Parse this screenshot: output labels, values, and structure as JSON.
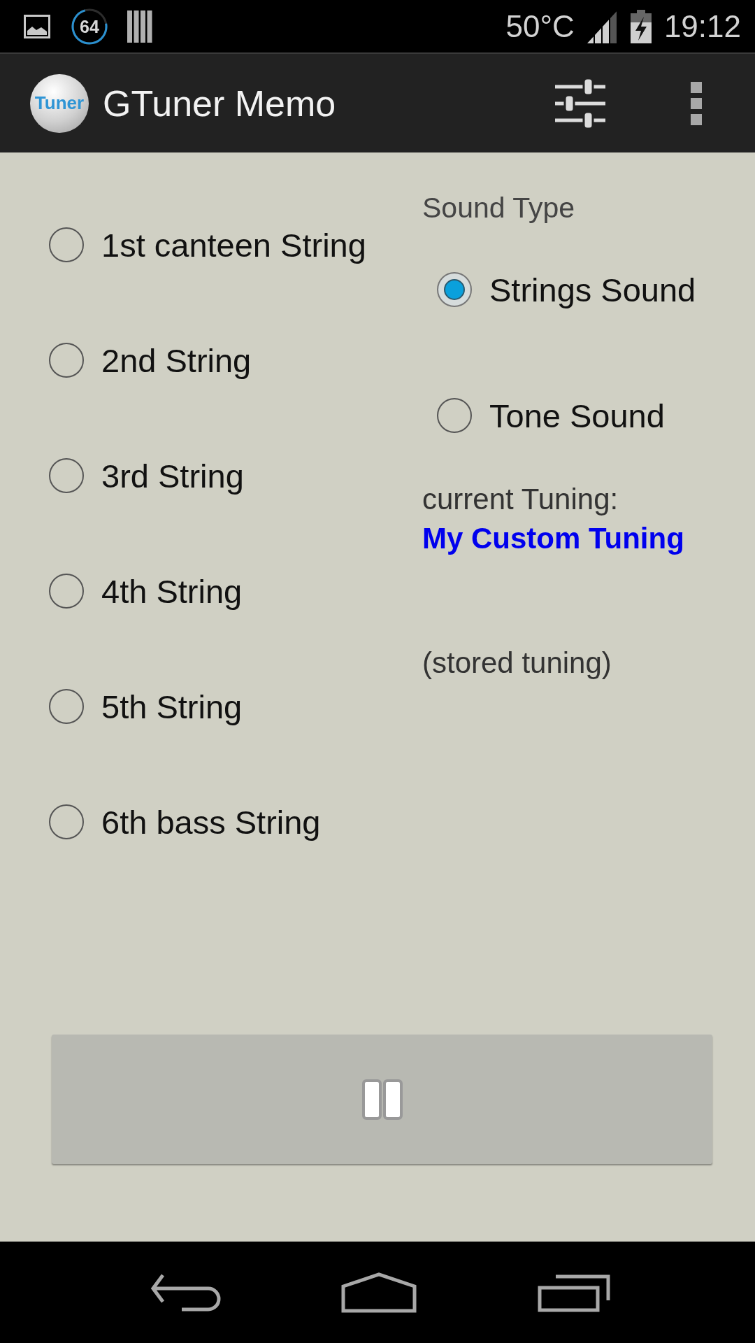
{
  "status_bar": {
    "ring_count": "64",
    "temperature": "50°C",
    "time": "19:12"
  },
  "app_bar": {
    "logo_text": "Tuner",
    "title": "GTuner Memo"
  },
  "strings": [
    {
      "label": "1st canteen String",
      "selected": false
    },
    {
      "label": "2nd String",
      "selected": false
    },
    {
      "label": "3rd String",
      "selected": false
    },
    {
      "label": "4th String",
      "selected": false
    },
    {
      "label": "5th String",
      "selected": false
    },
    {
      "label": "6th bass String",
      "selected": false
    }
  ],
  "sound_type": {
    "heading": "Sound Type",
    "options": [
      {
        "label": "Strings Sound",
        "selected": true
      },
      {
        "label": "Tone Sound",
        "selected": false
      }
    ]
  },
  "tuning": {
    "label": "current Tuning:",
    "name": "My Custom Tuning",
    "note": "(stored tuning)"
  },
  "play_button": {
    "playing": true
  }
}
